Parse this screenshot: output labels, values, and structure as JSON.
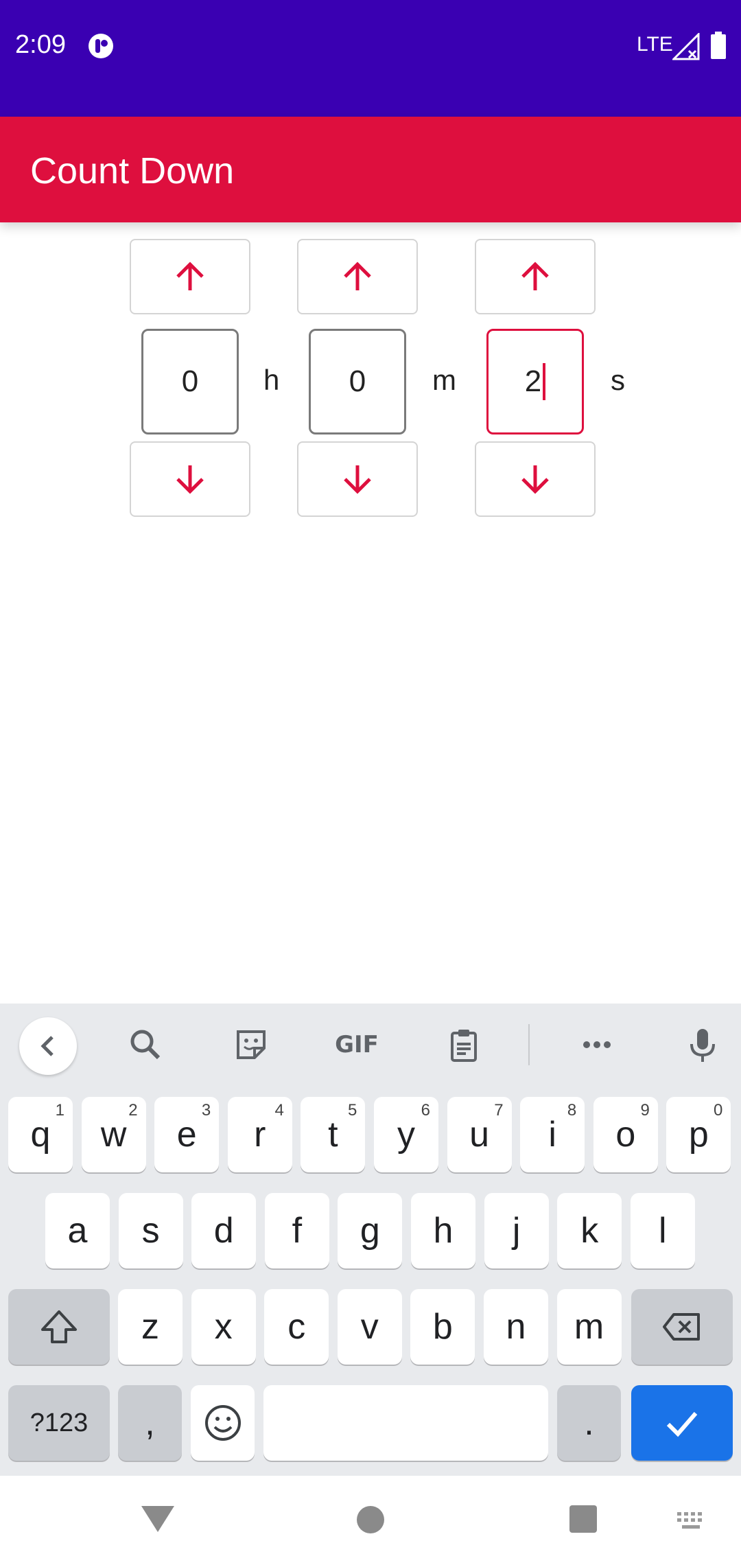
{
  "status_bar": {
    "time": "2:09",
    "network": "LTE",
    "icons": [
      "app-notification-icon",
      "signal-icon",
      "battery-icon"
    ]
  },
  "app_bar": {
    "title": "Count Down"
  },
  "timer": {
    "hours": "0",
    "minutes": "0",
    "seconds": "2",
    "hours_unit": "h",
    "minutes_unit": "m",
    "seconds_unit": "s",
    "focused_field": "seconds"
  },
  "keyboard": {
    "toolbar": {
      "gif_label": "GIF",
      "icons": [
        "chevron-left-icon",
        "search-icon",
        "sticker-icon",
        "clipboard-icon",
        "more-icon",
        "mic-icon"
      ]
    },
    "row1": [
      {
        "key": "q",
        "hint": "1"
      },
      {
        "key": "w",
        "hint": "2"
      },
      {
        "key": "e",
        "hint": "3"
      },
      {
        "key": "r",
        "hint": "4"
      },
      {
        "key": "t",
        "hint": "5"
      },
      {
        "key": "y",
        "hint": "6"
      },
      {
        "key": "u",
        "hint": "7"
      },
      {
        "key": "i",
        "hint": "8"
      },
      {
        "key": "o",
        "hint": "9"
      },
      {
        "key": "p",
        "hint": "0"
      }
    ],
    "row2": [
      "a",
      "s",
      "d",
      "f",
      "g",
      "h",
      "j",
      "k",
      "l"
    ],
    "row3": [
      "z",
      "x",
      "c",
      "v",
      "b",
      "n",
      "m"
    ],
    "symbols_label": "?123",
    "comma": ",",
    "period": "."
  },
  "colors": {
    "status_bar": "#3a00b2",
    "app_bar": "#de0f3e",
    "accent": "#de0f3e",
    "keyboard_bg": "#e8eaed",
    "action_key": "#1a73e8"
  }
}
